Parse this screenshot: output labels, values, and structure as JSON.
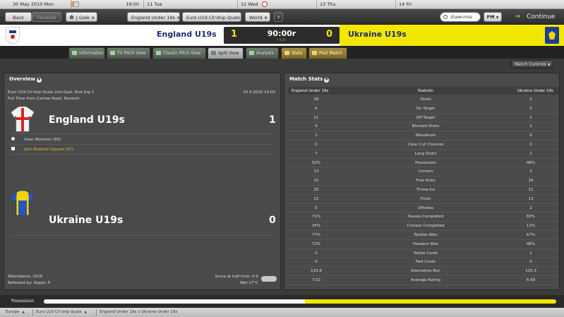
{
  "calendar": {
    "cells": [
      {
        "label": "30 May 2010 Mon",
        "icon": "trophy-icon"
      },
      {
        "label": "",
        "time": "19:00",
        "icon": "green-icon"
      },
      {
        "label": "11 Tue"
      },
      {
        "label": "12 Wed",
        "icon": "ball-icon"
      },
      {
        "label": "13 Thu"
      },
      {
        "label": "14 Fri"
      }
    ]
  },
  "nav": {
    "back": "Back",
    "forward": "Forward",
    "manager": "J Gale",
    "team": "England Under 19s",
    "competition": "Euro U19 Ch'ship Quals",
    "world": "World",
    "help": "?",
    "search_value": "shawcross",
    "fm_label": "FM",
    "continue": "Continue"
  },
  "score": {
    "home_team": "England U19s",
    "away_team": "Ukraine U19s",
    "home_goals": "1",
    "away_goals": "0",
    "clock": "90:00r",
    "added_time": "(+3)"
  },
  "tabs": [
    {
      "label": "Information"
    },
    {
      "label": "TV Pitch View"
    },
    {
      "label": "Classic Pitch View"
    },
    {
      "label": "Split View",
      "active": true
    },
    {
      "label": "Analysis"
    },
    {
      "label": "Stats"
    },
    {
      "label": "Post Match"
    }
  ],
  "match_controls": "Match Controls",
  "overview": {
    "title": "Overview",
    "competition": "Euro U19 Ch'ship Quals 2nd Qual. Rnd Grp 1",
    "date": "10.5.2010 19:00",
    "venue": "Full Time from Carrow Road, Norwich",
    "home": {
      "name": "England U19s",
      "score": "1"
    },
    "away": {
      "name": "Ukraine U19s",
      "score": "0"
    },
    "events": [
      {
        "text": "Sean Morrison (60)",
        "type": "goal"
      },
      {
        "text": "John Bostock injured (37)",
        "type": "injury"
      }
    ],
    "attendance": "Attendance: 2916",
    "referee": "Refereed by: Sippel, P",
    "halftime": "Score at half time: 0-0",
    "weather": "Wet 17°C"
  },
  "stats": {
    "title": "Match Stats",
    "header": {
      "home": "England Under 19s",
      "stat": "Statistic",
      "away": "Ukraine Under 19s"
    },
    "rows": [
      {
        "home": "26",
        "stat": "Shots",
        "away": "2"
      },
      {
        "home": "6",
        "stat": "On Target",
        "away": "0"
      },
      {
        "home": "11",
        "stat": "Off Target",
        "away": "1"
      },
      {
        "home": "9",
        "stat": "Blocked Shots",
        "away": "1"
      },
      {
        "home": "1",
        "stat": "Woodwork",
        "away": "0"
      },
      {
        "home": "0",
        "stat": "Clear Cut Chances",
        "away": "0"
      },
      {
        "home": "7",
        "stat": "Long Shots",
        "away": "2"
      },
      {
        "home": "52%",
        "stat": "Possession",
        "away": "48%"
      },
      {
        "home": "13",
        "stat": "Corners",
        "away": "3"
      },
      {
        "home": "15",
        "stat": "Free Kicks",
        "away": "16"
      },
      {
        "home": "25",
        "stat": "Throw-Ins",
        "away": "11"
      },
      {
        "home": "11",
        "stat": "Fouls",
        "away": "13"
      },
      {
        "home": "5",
        "stat": "Offsides",
        "away": "2"
      },
      {
        "home": "71%",
        "stat": "Passes Completed",
        "away": "60%"
      },
      {
        "home": "34%",
        "stat": "Crosses Completed",
        "away": "11%"
      },
      {
        "home": "77%",
        "stat": "Tackles Won",
        "away": "67%"
      },
      {
        "home": "72%",
        "stat": "Headers Won",
        "away": "48%"
      },
      {
        "home": "0",
        "stat": "Yellow Cards",
        "away": "1"
      },
      {
        "home": "0",
        "stat": "Red Cards",
        "away": "0"
      },
      {
        "home": "133.8",
        "stat": "Kilometres Run",
        "away": "125.3"
      },
      {
        "home": "7.02",
        "stat": "Average Rating",
        "away": "6.68"
      }
    ]
  },
  "possession": {
    "label": "Possession",
    "home_fraction": 0.51
  },
  "breadcrumbs": [
    "Europe",
    "Euro U19 Ch'ship Quals",
    "England Under 19s v Ukraine Under 19s"
  ],
  "colors": {
    "accent_yellow": "#f3e600",
    "home_blue": "#1c2f6e",
    "green": "#5fc54b"
  }
}
